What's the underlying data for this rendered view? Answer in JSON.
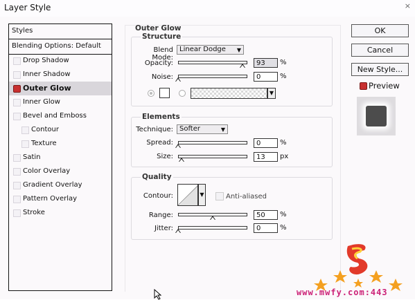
{
  "window": {
    "title": "Layer Style",
    "close_glyph": "×"
  },
  "styles_list": {
    "header": "Styles",
    "blending": "Blending Options: Default",
    "items": [
      {
        "label": "Drop Shadow",
        "checked": false,
        "active": false
      },
      {
        "label": "Inner Shadow",
        "checked": false,
        "active": false
      },
      {
        "label": "Outer Glow",
        "checked": true,
        "active": true
      },
      {
        "label": "Inner Glow",
        "checked": false,
        "active": false
      },
      {
        "label": "Bevel and Emboss",
        "checked": false,
        "active": false
      },
      {
        "label": "Contour",
        "checked": false,
        "active": false,
        "sub": true
      },
      {
        "label": "Texture",
        "checked": false,
        "active": false,
        "sub": true
      },
      {
        "label": "Satin",
        "checked": false,
        "active": false
      },
      {
        "label": "Color Overlay",
        "checked": false,
        "active": false
      },
      {
        "label": "Gradient Overlay",
        "checked": false,
        "active": false
      },
      {
        "label": "Pattern Overlay",
        "checked": false,
        "active": false
      },
      {
        "label": "Stroke",
        "checked": false,
        "active": false
      }
    ]
  },
  "outer_glow": {
    "title": "Outer Glow",
    "structure": {
      "title": "Structure",
      "blend_mode_label": "Blend Mode:",
      "blend_mode_value": "Linear Dodge",
      "opacity_label": "Opacity:",
      "opacity_value": "93",
      "opacity_unit": "%",
      "opacity_fraction": 0.93,
      "noise_label": "Noise:",
      "noise_value": "0",
      "noise_unit": "%",
      "noise_fraction": 0.0,
      "color_mode": "solid"
    },
    "elements": {
      "title": "Elements",
      "technique_label": "Technique:",
      "technique_value": "Softer",
      "spread_label": "Spread:",
      "spread_value": "0",
      "spread_unit": "%",
      "spread_fraction": 0.0,
      "size_label": "Size:",
      "size_value": "13",
      "size_unit": "px",
      "size_fraction": 0.052
    },
    "quality": {
      "title": "Quality",
      "contour_label": "Contour:",
      "anti_aliased_label": "Anti-aliased",
      "anti_aliased": false,
      "range_label": "Range:",
      "range_value": "50",
      "range_unit": "%",
      "range_fraction": 0.5,
      "jitter_label": "Jitter:",
      "jitter_value": "0",
      "jitter_unit": "%",
      "jitter_fraction": 0.0
    }
  },
  "buttons": {
    "ok": "OK",
    "cancel": "Cancel",
    "new_style": "New Style...",
    "preview": "Preview"
  },
  "watermark": {
    "text": "www.mwfy.com:443"
  },
  "colors": {
    "active_bullet": "#c83030",
    "swatch": "#4c4c4c",
    "logo_orange": "#f4a020",
    "logo_pink": "#cc2277"
  }
}
